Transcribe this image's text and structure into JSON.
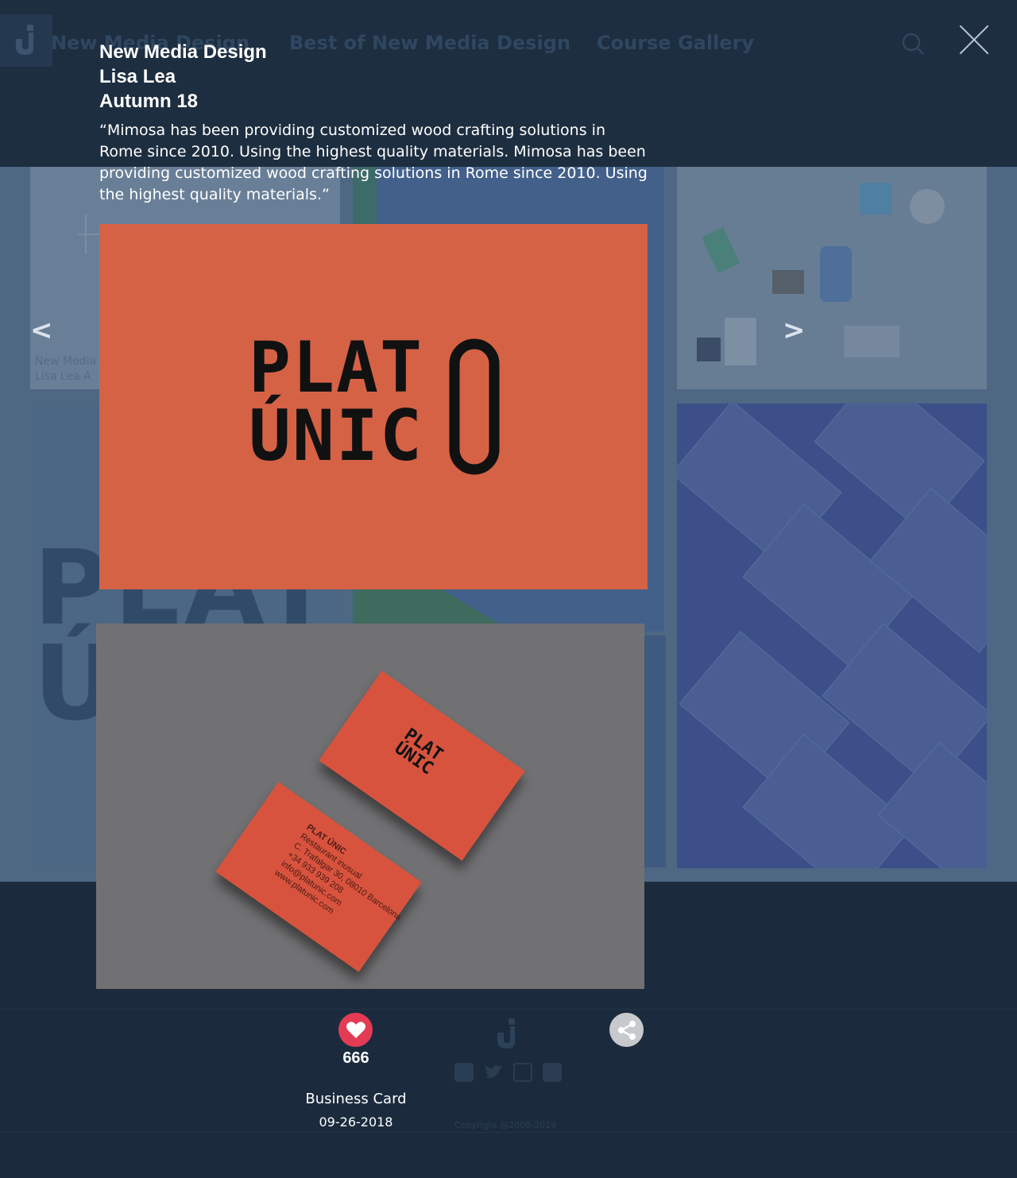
{
  "nav": {
    "items": [
      "New Media Design",
      "Best of New Media Design",
      "Course Gallery"
    ]
  },
  "gallery_caption": {
    "line1": "New Media",
    "line2": "Lisa Lea   A"
  },
  "gallery_big_text": {
    "line1": "PLAT",
    "line2": "Ú"
  },
  "project": {
    "course": "New Media Design",
    "author": "Lisa Lea",
    "term": "Autumn 18",
    "description": "“Mimosa has been providing customized wood crafting solutions in Rome since 2010. Using the highest quality materials. Mimosa has been providing customized wood crafting solutions in Rome since 2010. Using the highest quality materials.”",
    "image1_logo": {
      "line1": "PLAT",
      "line2": "ÚNIC"
    },
    "image2_logo": {
      "line1": "PLAT",
      "line2": "ÚNIC"
    },
    "card_lines": [
      "PLAT ÚNIC",
      "Restaurant inusual",
      "C. Trafalgar 30, 08010 Barcelona",
      "+34 933 939 208",
      "info@platunic.com",
      "www.platunic.com"
    ],
    "likes": "666",
    "category": "Business Card",
    "date": "09-26-2018"
  },
  "controls": {
    "prev_label": "<",
    "next_label": ">"
  },
  "footer": {
    "copyright": "Copyright @2009-2019"
  },
  "icons": [
    "logo-icon",
    "search-icon",
    "close-icon",
    "heart-icon",
    "share-icon",
    "facebook-icon",
    "twitter-icon",
    "instagram-icon",
    "youtube-icon"
  ],
  "colors": {
    "accent_like": "#e43b54",
    "card_orange": "#d56245",
    "background": "#1b2b3d"
  }
}
